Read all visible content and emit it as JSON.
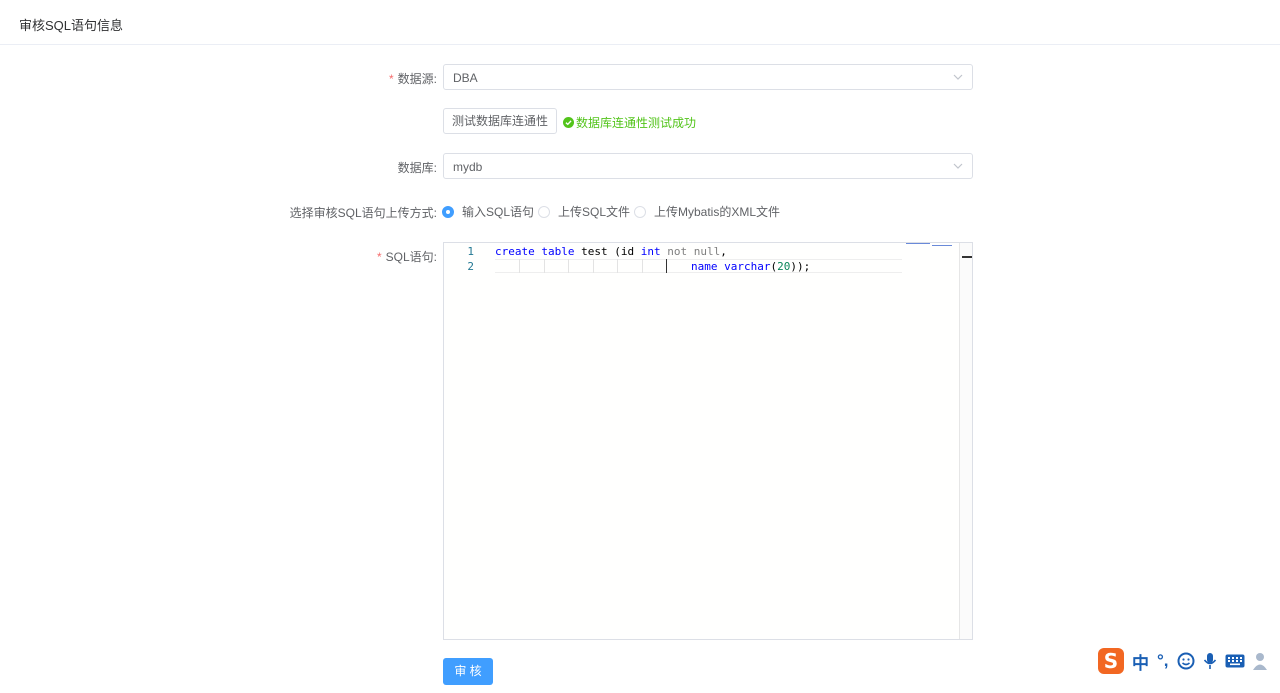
{
  "header": {
    "title": "审核SQL语句信息"
  },
  "form": {
    "datasource": {
      "required_mark": "*",
      "label": "数据源:",
      "value": "DBA"
    },
    "test_button": {
      "label": "测试数据库连通性"
    },
    "test_result": {
      "text": "数据库连通性测试成功",
      "color": "#52c41a"
    },
    "database": {
      "label": "数据库:",
      "value": "mydb"
    },
    "upload_mode": {
      "label": "选择审核SQL语句上传方式:",
      "options": [
        "输入SQL语句",
        "上传SQL文件",
        "上传Mybatis的XML文件"
      ],
      "selected": "输入SQL语句"
    },
    "sql": {
      "required_mark": "*",
      "label": "SQL语句:",
      "line_numbers": [
        "1",
        "2"
      ],
      "line1": {
        "t1": "create",
        "t2": " ",
        "t3": "table",
        "t4": " test (id ",
        "t5": "int",
        "t6": " ",
        "t7": "not null",
        "t8": ","
      },
      "line2": {
        "t1": "name",
        "t2": " ",
        "t3": "varchar",
        "t4": "(",
        "t5": "20",
        "t6": "));"
      }
    },
    "submit_button": {
      "label": "审 核",
      "color": "#409eff"
    }
  },
  "ime_toolbar": {
    "logo": "S",
    "lang": "中",
    "punct": "°,",
    "icons": [
      "smiley-icon",
      "microphone-icon",
      "keyboard-icon",
      "user-icon"
    ],
    "color": "#f26722"
  }
}
